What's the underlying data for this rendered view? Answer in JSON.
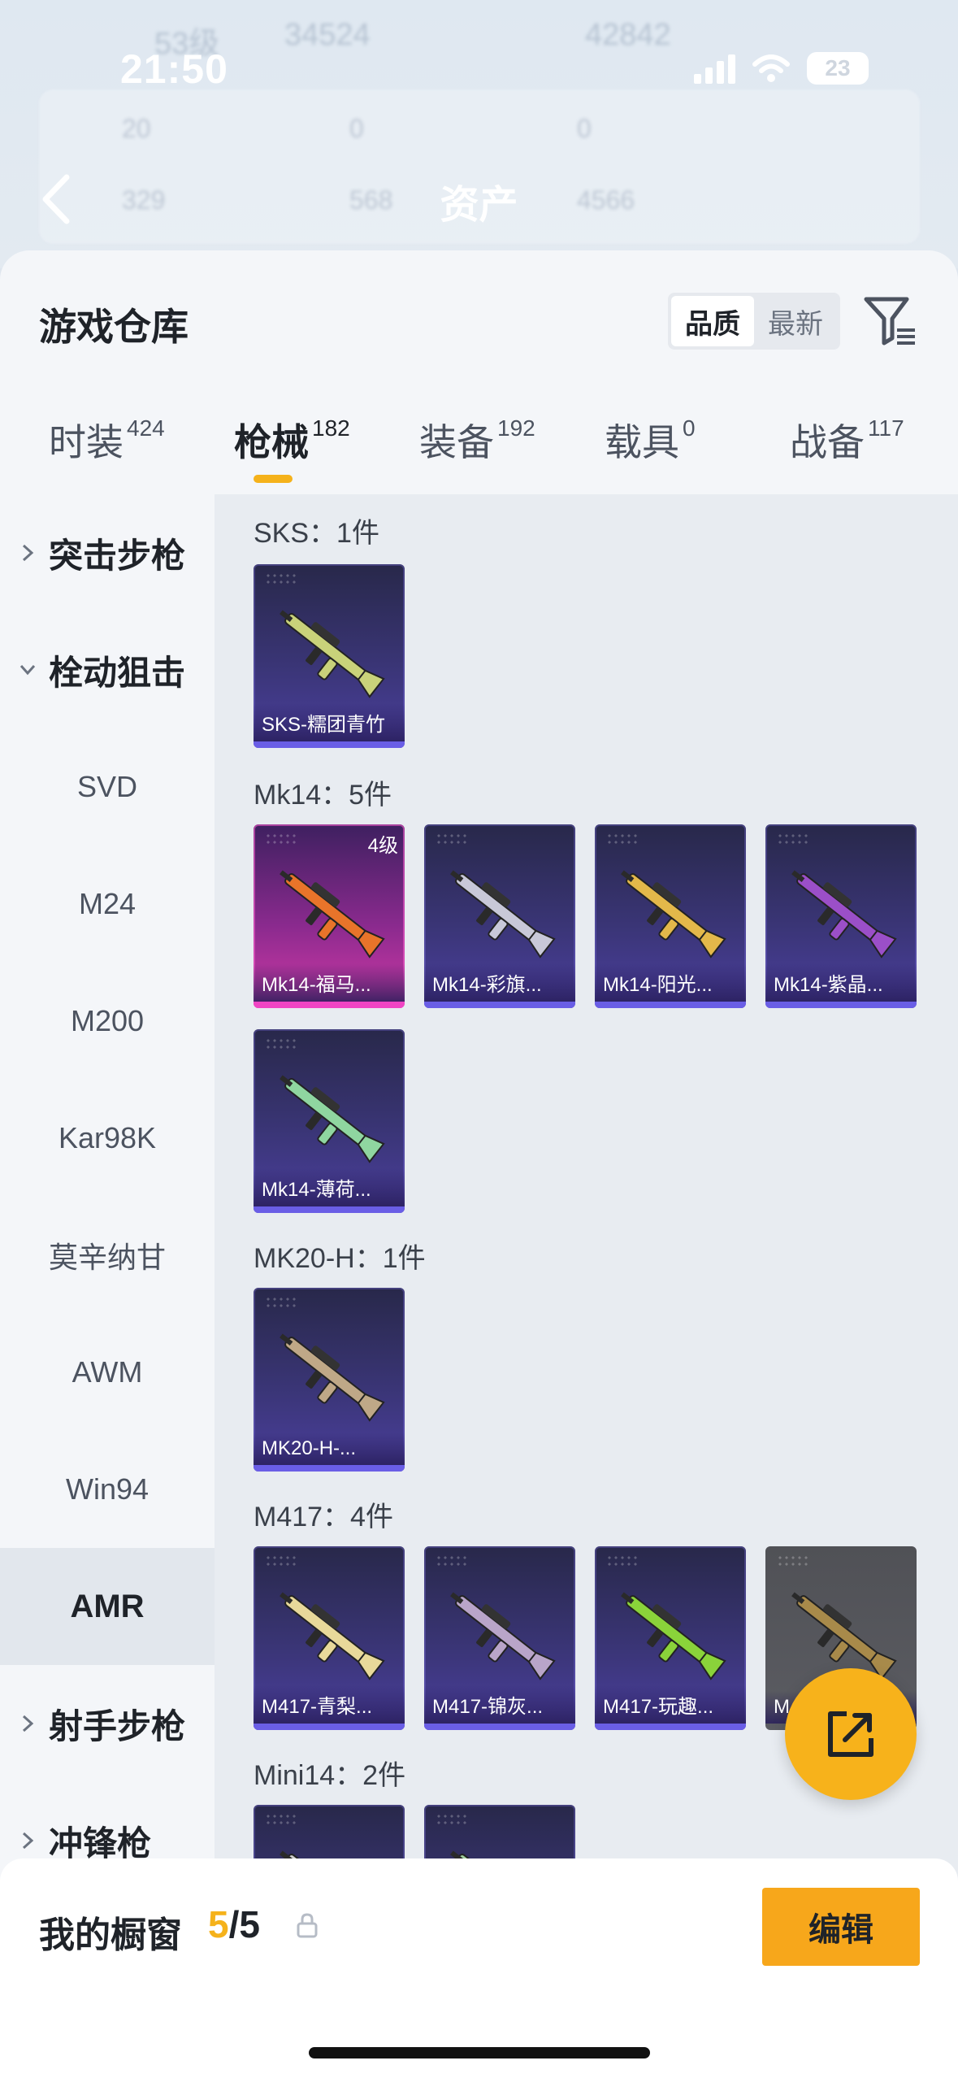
{
  "status_bar": {
    "time": "21:50",
    "battery": "23"
  },
  "background": {
    "ghost_level": "53级",
    "ghost_points": "34524",
    "ghost_right": "42842",
    "ghost_stats": [
      "20",
      "0",
      "0",
      "329",
      "568",
      "4566"
    ]
  },
  "nav": {
    "title": "资产"
  },
  "warehouse": {
    "title": "游戏仓库",
    "sort_options": [
      {
        "label": "品质",
        "active": true
      },
      {
        "label": "最新",
        "active": false
      }
    ]
  },
  "tabs": [
    {
      "label": "时装",
      "count": "424",
      "active": false
    },
    {
      "label": "枪械",
      "count": "182",
      "active": true
    },
    {
      "label": "装备",
      "count": "192",
      "active": false
    },
    {
      "label": "载具",
      "count": "0",
      "active": false
    },
    {
      "label": "战备",
      "count": "117",
      "active": false
    }
  ],
  "sidebar": {
    "items": [
      {
        "label": "突击步枪",
        "type": "group",
        "expanded": false
      },
      {
        "label": "栓动狙击",
        "type": "group",
        "expanded": true
      },
      {
        "label": "SVD",
        "type": "sub"
      },
      {
        "label": "M24",
        "type": "sub"
      },
      {
        "label": "M200",
        "type": "sub"
      },
      {
        "label": "Kar98K",
        "type": "sub"
      },
      {
        "label": "莫辛纳甘",
        "type": "sub"
      },
      {
        "label": "AWM",
        "type": "sub"
      },
      {
        "label": "Win94",
        "type": "sub"
      },
      {
        "label": "AMR",
        "type": "sub",
        "selected": true
      },
      {
        "label": "射手步枪",
        "type": "group",
        "expanded": false
      },
      {
        "label": "冲锋枪",
        "type": "group",
        "expanded": false
      }
    ]
  },
  "sections": [
    {
      "title": "SKS：1件",
      "items": [
        {
          "name": "SKS-糯团青竹",
          "style": "purple",
          "color": "#c9d27a"
        }
      ]
    },
    {
      "title": "Mk14：5件",
      "items": [
        {
          "name": "Mk14-福马...",
          "style": "pink",
          "level": "4级",
          "color": "#e8742a"
        },
        {
          "name": "Mk14-彩旗...",
          "style": "purple",
          "color": "#c8c8d8"
        },
        {
          "name": "Mk14-阳光...",
          "style": "purple",
          "color": "#e3b84a"
        },
        {
          "name": "Mk14-紫晶...",
          "style": "purple",
          "color": "#9b4fc8"
        },
        {
          "name": "Mk14-薄荷...",
          "style": "purple",
          "color": "#8fd6a0"
        }
      ]
    },
    {
      "title": "MK20-H：1件",
      "items": [
        {
          "name": "MK20-H-...",
          "style": "purple",
          "color": "#bfa887"
        }
      ]
    },
    {
      "title": "M417：4件",
      "items": [
        {
          "name": "M417-青梨...",
          "style": "purple",
          "color": "#e8d99a"
        },
        {
          "name": "M417-锦灰...",
          "style": "purple",
          "color": "#b9a5c9"
        },
        {
          "name": "M417-玩趣...",
          "style": "purple",
          "color": "#8ad33a"
        },
        {
          "name": "M",
          "style": "grey",
          "color": "#a88a4a"
        }
      ]
    },
    {
      "title": "Mini14：2件",
      "items": [
        {
          "name": "",
          "style": "purple",
          "color": "#cfcfcf"
        },
        {
          "name": "",
          "style": "purple",
          "color": "#a0d0a0"
        }
      ]
    }
  ],
  "window": {
    "label": "我的橱窗",
    "current": "5",
    "total": "/5",
    "edit_label": "编辑"
  },
  "colors": {
    "accent": "#f5b21b",
    "card_purple": "#3a3576",
    "card_pink": "#d33aa6"
  }
}
